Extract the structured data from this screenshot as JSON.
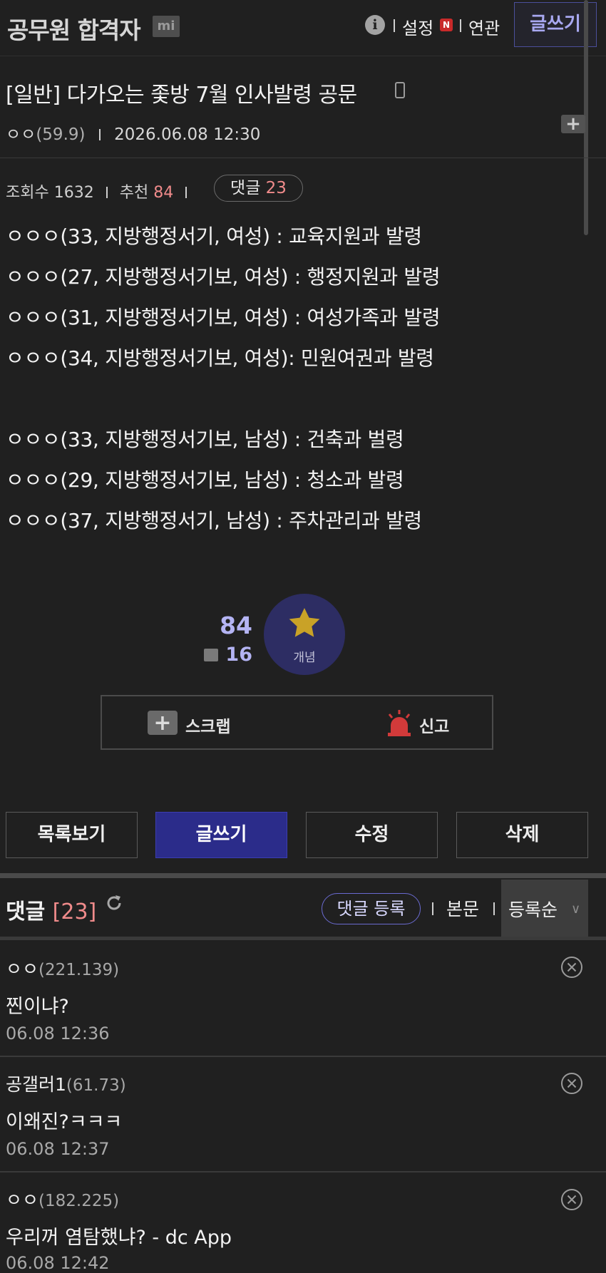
{
  "header": {
    "gallery_name": "공무원 합격자",
    "gallery_badge": "mi",
    "settings_label": "설정",
    "new_badge": "N",
    "related_label": "연관",
    "write_label": "글쓰기",
    "info_icon": "info-icon"
  },
  "post": {
    "title": "[일반] 다가오는 좇방 7월 인사발령 공문",
    "author": "ㅇㅇ",
    "author_ip": "(59.9)",
    "datetime": "2026.06.08 12:30",
    "views_label": "조회수",
    "views": "1632",
    "recommend_label": "추천",
    "recommend": "84",
    "comment_label": "댓글",
    "comment_count": "23",
    "body_lines": [
      "ㅇㅇㅇ(33, 지방행정서기, 여성) : 교육지원과 발령",
      "ㅇㅇㅇ(27, 지방행정서기보, 여성) : 행정지원과 발령",
      "ㅇㅇㅇ(31, 지방행정서기보, 여성) : 여성가족과 발령",
      "ㅇㅇㅇ(34, 지방행정서기보, 여성): 민원여권과 발령",
      "ㅇㅇㅇ(33, 지방행정서기보, 남성) : 건축과 벌령",
      "ㅇㅇㅇ(29, 지방행정서기보, 남성) : 청소과 발령",
      "ㅇㅇㅇ(37, 지방행정서기, 남성) : 주차관리과 발령"
    ]
  },
  "recommend_box": {
    "count": "84",
    "fix_count": "16",
    "button_label": "개념",
    "scrap_label": "스크랩",
    "report_label": "신고"
  },
  "buttons": {
    "list": "목록보기",
    "write": "글쓰기",
    "edit": "수정",
    "delete": "삭제"
  },
  "comments": {
    "title": "댓글",
    "total": "[23]",
    "register_label": "댓글 등록",
    "body_link": "본문",
    "order_label": "등록순",
    "items": [
      {
        "nick": "ㅇㅇ",
        "ip": "(221.139)",
        "text": "찐이냐?",
        "date": "06.08 12:36"
      },
      {
        "nick": "공갤러1",
        "ip": "(61.73)",
        "text": "이왜진?ㅋㅋㅋ",
        "date": "06.08 12:37"
      },
      {
        "nick": "ㅇㅇ",
        "ip": "(182.225)",
        "text": "우리꺼 염탐했냐? - dc App",
        "date": "06.08 12:42"
      }
    ]
  },
  "colors": {
    "background": "#202020",
    "accent": "#2b2c8a",
    "accent_text": "#b4b4f4",
    "count_red": "#f08b8b"
  }
}
